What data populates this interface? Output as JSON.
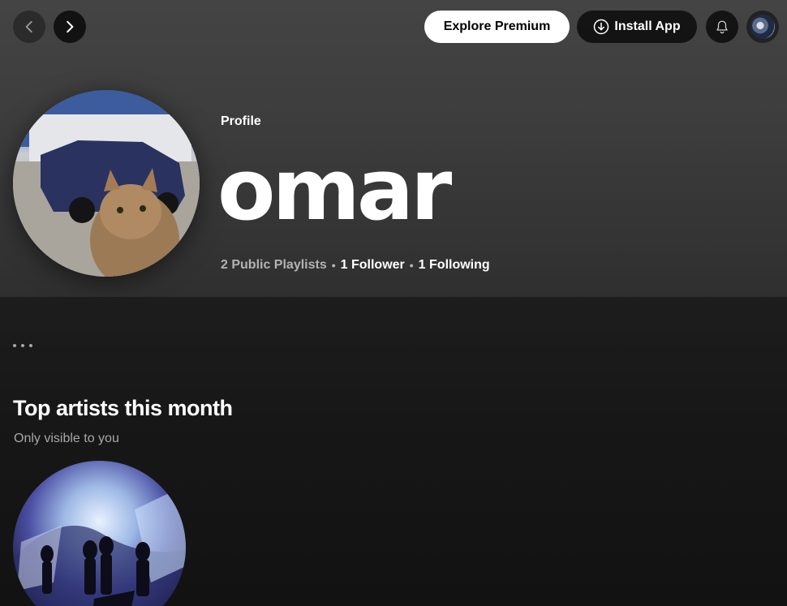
{
  "topbar": {
    "explore_premium": "Explore Premium",
    "install_app": "Install App"
  },
  "profile": {
    "type_label": "Profile",
    "name": "omar",
    "playlists": "2 Public Playlists",
    "followers": "1 Follower",
    "following": "1 Following",
    "separator": "•"
  },
  "top_artists": {
    "title": "Top artists this month",
    "subtitle": "Only visible to you"
  },
  "colors": {
    "background": "#121212",
    "hero_gray": "#404040",
    "premium_button": "#ffffff",
    "muted_text": "#a7a7a7"
  },
  "icons": [
    "chevron-left-icon",
    "chevron-right-icon",
    "download-icon",
    "bell-icon",
    "more-dots-icon"
  ]
}
